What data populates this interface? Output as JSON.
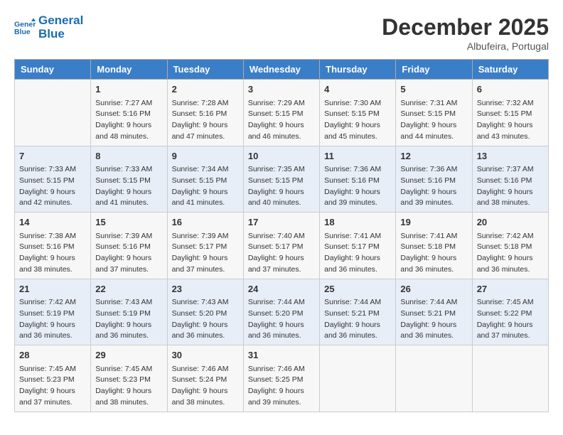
{
  "header": {
    "logo_line1": "General",
    "logo_line2": "Blue",
    "month_title": "December 2025",
    "location": "Albufeira, Portugal"
  },
  "columns": [
    "Sunday",
    "Monday",
    "Tuesday",
    "Wednesday",
    "Thursday",
    "Friday",
    "Saturday"
  ],
  "weeks": [
    [
      {
        "day": "",
        "sunrise": "",
        "sunset": "",
        "daylight": ""
      },
      {
        "day": "1",
        "sunrise": "Sunrise: 7:27 AM",
        "sunset": "Sunset: 5:16 PM",
        "daylight": "Daylight: 9 hours and 48 minutes."
      },
      {
        "day": "2",
        "sunrise": "Sunrise: 7:28 AM",
        "sunset": "Sunset: 5:16 PM",
        "daylight": "Daylight: 9 hours and 47 minutes."
      },
      {
        "day": "3",
        "sunrise": "Sunrise: 7:29 AM",
        "sunset": "Sunset: 5:15 PM",
        "daylight": "Daylight: 9 hours and 46 minutes."
      },
      {
        "day": "4",
        "sunrise": "Sunrise: 7:30 AM",
        "sunset": "Sunset: 5:15 PM",
        "daylight": "Daylight: 9 hours and 45 minutes."
      },
      {
        "day": "5",
        "sunrise": "Sunrise: 7:31 AM",
        "sunset": "Sunset: 5:15 PM",
        "daylight": "Daylight: 9 hours and 44 minutes."
      },
      {
        "day": "6",
        "sunrise": "Sunrise: 7:32 AM",
        "sunset": "Sunset: 5:15 PM",
        "daylight": "Daylight: 9 hours and 43 minutes."
      }
    ],
    [
      {
        "day": "7",
        "sunrise": "Sunrise: 7:33 AM",
        "sunset": "Sunset: 5:15 PM",
        "daylight": "Daylight: 9 hours and 42 minutes."
      },
      {
        "day": "8",
        "sunrise": "Sunrise: 7:33 AM",
        "sunset": "Sunset: 5:15 PM",
        "daylight": "Daylight: 9 hours and 41 minutes."
      },
      {
        "day": "9",
        "sunrise": "Sunrise: 7:34 AM",
        "sunset": "Sunset: 5:15 PM",
        "daylight": "Daylight: 9 hours and 41 minutes."
      },
      {
        "day": "10",
        "sunrise": "Sunrise: 7:35 AM",
        "sunset": "Sunset: 5:15 PM",
        "daylight": "Daylight: 9 hours and 40 minutes."
      },
      {
        "day": "11",
        "sunrise": "Sunrise: 7:36 AM",
        "sunset": "Sunset: 5:16 PM",
        "daylight": "Daylight: 9 hours and 39 minutes."
      },
      {
        "day": "12",
        "sunrise": "Sunrise: 7:36 AM",
        "sunset": "Sunset: 5:16 PM",
        "daylight": "Daylight: 9 hours and 39 minutes."
      },
      {
        "day": "13",
        "sunrise": "Sunrise: 7:37 AM",
        "sunset": "Sunset: 5:16 PM",
        "daylight": "Daylight: 9 hours and 38 minutes."
      }
    ],
    [
      {
        "day": "14",
        "sunrise": "Sunrise: 7:38 AM",
        "sunset": "Sunset: 5:16 PM",
        "daylight": "Daylight: 9 hours and 38 minutes."
      },
      {
        "day": "15",
        "sunrise": "Sunrise: 7:39 AM",
        "sunset": "Sunset: 5:16 PM",
        "daylight": "Daylight: 9 hours and 37 minutes."
      },
      {
        "day": "16",
        "sunrise": "Sunrise: 7:39 AM",
        "sunset": "Sunset: 5:17 PM",
        "daylight": "Daylight: 9 hours and 37 minutes."
      },
      {
        "day": "17",
        "sunrise": "Sunrise: 7:40 AM",
        "sunset": "Sunset: 5:17 PM",
        "daylight": "Daylight: 9 hours and 37 minutes."
      },
      {
        "day": "18",
        "sunrise": "Sunrise: 7:41 AM",
        "sunset": "Sunset: 5:17 PM",
        "daylight": "Daylight: 9 hours and 36 minutes."
      },
      {
        "day": "19",
        "sunrise": "Sunrise: 7:41 AM",
        "sunset": "Sunset: 5:18 PM",
        "daylight": "Daylight: 9 hours and 36 minutes."
      },
      {
        "day": "20",
        "sunrise": "Sunrise: 7:42 AM",
        "sunset": "Sunset: 5:18 PM",
        "daylight": "Daylight: 9 hours and 36 minutes."
      }
    ],
    [
      {
        "day": "21",
        "sunrise": "Sunrise: 7:42 AM",
        "sunset": "Sunset: 5:19 PM",
        "daylight": "Daylight: 9 hours and 36 minutes."
      },
      {
        "day": "22",
        "sunrise": "Sunrise: 7:43 AM",
        "sunset": "Sunset: 5:19 PM",
        "daylight": "Daylight: 9 hours and 36 minutes."
      },
      {
        "day": "23",
        "sunrise": "Sunrise: 7:43 AM",
        "sunset": "Sunset: 5:20 PM",
        "daylight": "Daylight: 9 hours and 36 minutes."
      },
      {
        "day": "24",
        "sunrise": "Sunrise: 7:44 AM",
        "sunset": "Sunset: 5:20 PM",
        "daylight": "Daylight: 9 hours and 36 minutes."
      },
      {
        "day": "25",
        "sunrise": "Sunrise: 7:44 AM",
        "sunset": "Sunset: 5:21 PM",
        "daylight": "Daylight: 9 hours and 36 minutes."
      },
      {
        "day": "26",
        "sunrise": "Sunrise: 7:44 AM",
        "sunset": "Sunset: 5:21 PM",
        "daylight": "Daylight: 9 hours and 36 minutes."
      },
      {
        "day": "27",
        "sunrise": "Sunrise: 7:45 AM",
        "sunset": "Sunset: 5:22 PM",
        "daylight": "Daylight: 9 hours and 37 minutes."
      }
    ],
    [
      {
        "day": "28",
        "sunrise": "Sunrise: 7:45 AM",
        "sunset": "Sunset: 5:23 PM",
        "daylight": "Daylight: 9 hours and 37 minutes."
      },
      {
        "day": "29",
        "sunrise": "Sunrise: 7:45 AM",
        "sunset": "Sunset: 5:23 PM",
        "daylight": "Daylight: 9 hours and 38 minutes."
      },
      {
        "day": "30",
        "sunrise": "Sunrise: 7:46 AM",
        "sunset": "Sunset: 5:24 PM",
        "daylight": "Daylight: 9 hours and 38 minutes."
      },
      {
        "day": "31",
        "sunrise": "Sunrise: 7:46 AM",
        "sunset": "Sunset: 5:25 PM",
        "daylight": "Daylight: 9 hours and 39 minutes."
      },
      {
        "day": "",
        "sunrise": "",
        "sunset": "",
        "daylight": ""
      },
      {
        "day": "",
        "sunrise": "",
        "sunset": "",
        "daylight": ""
      },
      {
        "day": "",
        "sunrise": "",
        "sunset": "",
        "daylight": ""
      }
    ]
  ]
}
